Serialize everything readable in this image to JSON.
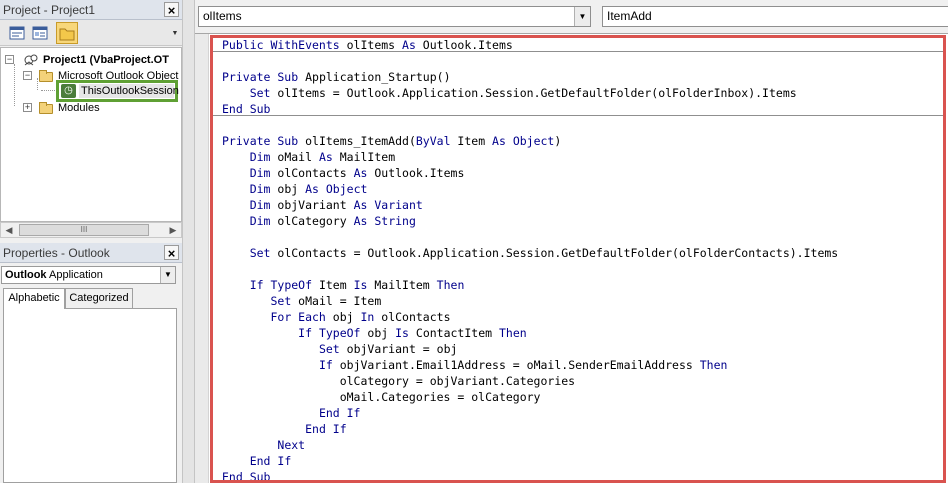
{
  "project_pane": {
    "title": "Project - Project1",
    "close": "×",
    "tree": {
      "root": "Project1 (VbaProject.OT",
      "objects_folder": "Microsoft Outlook Object",
      "session": "ThisOutlookSession",
      "modules": "Modules"
    },
    "hscroll_grip": "III"
  },
  "properties_pane": {
    "title": "Properties - Outlook",
    "close": "×",
    "object_name": "Outlook",
    "object_type": "Application",
    "tabs": [
      "Alphabetic",
      "Categorized"
    ]
  },
  "code_window": {
    "object_combo": "olItems",
    "procedure_combo": "ItemAdd",
    "lines": [
      [
        {
          "k": 1,
          "t": "Public WithEvents"
        },
        {
          "k": 0,
          "t": " olItems "
        },
        {
          "k": 1,
          "t": "As"
        },
        {
          "k": 0,
          "t": " Outlook.Items"
        }
      ],
      [],
      [
        {
          "k": 1,
          "t": "Private Sub"
        },
        {
          "k": 0,
          "t": " Application_Startup()"
        }
      ],
      [
        {
          "k": 0,
          "t": "    "
        },
        {
          "k": 1,
          "t": "Set"
        },
        {
          "k": 0,
          "t": " olItems = Outlook.Application.Session.GetDefaultFolder(olFolderInbox).Items"
        }
      ],
      [
        {
          "k": 1,
          "t": "End Sub"
        }
      ],
      [],
      [
        {
          "k": 1,
          "t": "Private Sub"
        },
        {
          "k": 0,
          "t": " olItems_ItemAdd("
        },
        {
          "k": 1,
          "t": "ByVal"
        },
        {
          "k": 0,
          "t": " Item "
        },
        {
          "k": 1,
          "t": "As Object"
        },
        {
          "k": 0,
          "t": ")"
        }
      ],
      [
        {
          "k": 0,
          "t": "    "
        },
        {
          "k": 1,
          "t": "Dim"
        },
        {
          "k": 0,
          "t": " oMail "
        },
        {
          "k": 1,
          "t": "As"
        },
        {
          "k": 0,
          "t": " MailItem"
        }
      ],
      [
        {
          "k": 0,
          "t": "    "
        },
        {
          "k": 1,
          "t": "Dim"
        },
        {
          "k": 0,
          "t": " olContacts "
        },
        {
          "k": 1,
          "t": "As"
        },
        {
          "k": 0,
          "t": " Outlook.Items"
        }
      ],
      [
        {
          "k": 0,
          "t": "    "
        },
        {
          "k": 1,
          "t": "Dim"
        },
        {
          "k": 0,
          "t": " obj "
        },
        {
          "k": 1,
          "t": "As Object"
        }
      ],
      [
        {
          "k": 0,
          "t": "    "
        },
        {
          "k": 1,
          "t": "Dim"
        },
        {
          "k": 0,
          "t": " objVariant "
        },
        {
          "k": 1,
          "t": "As Variant"
        }
      ],
      [
        {
          "k": 0,
          "t": "    "
        },
        {
          "k": 1,
          "t": "Dim"
        },
        {
          "k": 0,
          "t": " olCategory "
        },
        {
          "k": 1,
          "t": "As String"
        }
      ],
      [],
      [
        {
          "k": 0,
          "t": "    "
        },
        {
          "k": 1,
          "t": "Set"
        },
        {
          "k": 0,
          "t": " olContacts = Outlook.Application.Session.GetDefaultFolder(olFolderContacts).Items"
        }
      ],
      [],
      [
        {
          "k": 0,
          "t": "    "
        },
        {
          "k": 1,
          "t": "If TypeOf"
        },
        {
          "k": 0,
          "t": " Item "
        },
        {
          "k": 1,
          "t": "Is"
        },
        {
          "k": 0,
          "t": " MailItem "
        },
        {
          "k": 1,
          "t": "Then"
        }
      ],
      [
        {
          "k": 0,
          "t": "       "
        },
        {
          "k": 1,
          "t": "Set"
        },
        {
          "k": 0,
          "t": " oMail = Item"
        }
      ],
      [
        {
          "k": 0,
          "t": "       "
        },
        {
          "k": 1,
          "t": "For Each"
        },
        {
          "k": 0,
          "t": " obj "
        },
        {
          "k": 1,
          "t": "In"
        },
        {
          "k": 0,
          "t": " olContacts"
        }
      ],
      [
        {
          "k": 0,
          "t": "           "
        },
        {
          "k": 1,
          "t": "If TypeOf"
        },
        {
          "k": 0,
          "t": " obj "
        },
        {
          "k": 1,
          "t": "Is"
        },
        {
          "k": 0,
          "t": " ContactItem "
        },
        {
          "k": 1,
          "t": "Then"
        }
      ],
      [
        {
          "k": 0,
          "t": "              "
        },
        {
          "k": 1,
          "t": "Set"
        },
        {
          "k": 0,
          "t": " objVariant = obj"
        }
      ],
      [
        {
          "k": 0,
          "t": "              "
        },
        {
          "k": 1,
          "t": "If"
        },
        {
          "k": 0,
          "t": " objVariant.Email1Address = oMail.SenderEmailAddress "
        },
        {
          "k": 1,
          "t": "Then"
        }
      ],
      [
        {
          "k": 0,
          "t": "                 olCategory = objVariant.Categories"
        }
      ],
      [
        {
          "k": 0,
          "t": "                 oMail.Categories = olCategory"
        }
      ],
      [
        {
          "k": 0,
          "t": "              "
        },
        {
          "k": 1,
          "t": "End If"
        }
      ],
      [
        {
          "k": 0,
          "t": "            "
        },
        {
          "k": 1,
          "t": "End If"
        }
      ],
      [
        {
          "k": 0,
          "t": "        "
        },
        {
          "k": 1,
          "t": "Next"
        }
      ],
      [
        {
          "k": 0,
          "t": "    "
        },
        {
          "k": 1,
          "t": "End If"
        }
      ],
      [
        {
          "k": 1,
          "t": "End Sub"
        }
      ]
    ]
  },
  "colors": {
    "keyword": "#00008b",
    "highlight_box": "#d9534f",
    "selection_box": "#5fa034"
  }
}
